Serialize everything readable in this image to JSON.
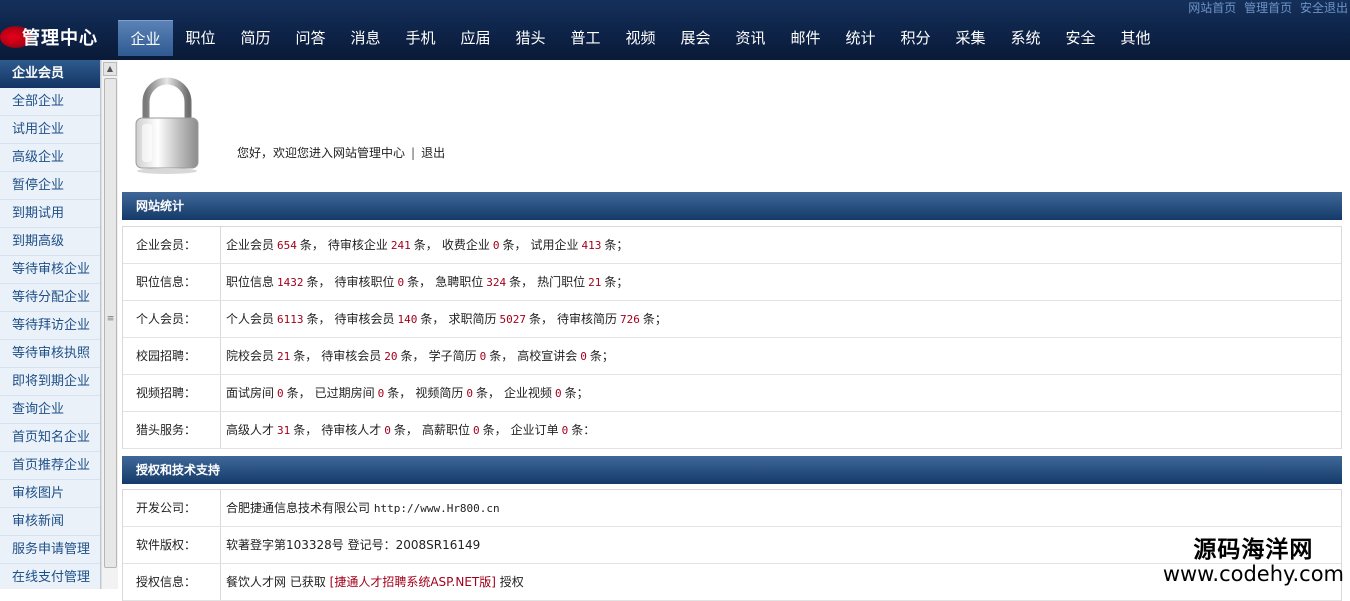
{
  "header": {
    "top_links": [
      "网站首页",
      "管理首页",
      "安全退出"
    ],
    "logo_text": "管理中心",
    "nav": [
      "企业",
      "职位",
      "简历",
      "问答",
      "消息",
      "手机",
      "应届",
      "猎头",
      "普工",
      "视频",
      "展会",
      "资讯",
      "邮件",
      "统计",
      "积分",
      "采集",
      "系统",
      "安全",
      "其他"
    ],
    "active_nav": "企业"
  },
  "sidebar": {
    "title": "企业会员",
    "items": [
      "全部企业",
      "试用企业",
      "高级企业",
      "暂停企业",
      "到期试用",
      "到期高级",
      "等待审核企业",
      "等待分配企业",
      "等待拜访企业",
      "等待审核执照",
      "即将到期企业",
      "查询企业",
      "首页知名企业",
      "首页推荐企业",
      "审核图片",
      "审核新闻",
      "服务申请管理",
      "在线支付管理"
    ]
  },
  "welcome": {
    "text": "您好，欢迎您进入网站管理中心",
    "separator": "|",
    "logout": "退出"
  },
  "stats": {
    "title": "网站统计",
    "rows": [
      {
        "label": "企业会员：",
        "parts": [
          [
            "企业会员",
            "654",
            "条，"
          ],
          [
            "待审核企业",
            "241",
            "条，"
          ],
          [
            "收费企业",
            "0",
            "条，"
          ],
          [
            "试用企业",
            "413",
            "条；"
          ]
        ]
      },
      {
        "label": "职位信息：",
        "parts": [
          [
            "职位信息",
            "1432",
            "条，"
          ],
          [
            "待审核职位",
            "0",
            "条，"
          ],
          [
            "急聘职位",
            "324",
            "条，"
          ],
          [
            "热门职位",
            "21",
            "条；"
          ]
        ]
      },
      {
        "label": "个人会员：",
        "parts": [
          [
            "个人会员",
            "6113",
            "条，"
          ],
          [
            "待审核会员",
            "140",
            "条，"
          ],
          [
            "求职简历",
            "5027",
            "条，"
          ],
          [
            "待审核简历",
            "726",
            "条；"
          ]
        ]
      },
      {
        "label": "校园招聘：",
        "parts": [
          [
            "院校会员",
            "21",
            "条，"
          ],
          [
            "待审核会员",
            "20",
            "条，"
          ],
          [
            "学子简历",
            "0",
            "条，"
          ],
          [
            "高校宣讲会",
            "0",
            "条；"
          ]
        ]
      },
      {
        "label": "视频招聘：",
        "parts": [
          [
            "面试房间",
            "0",
            "条，"
          ],
          [
            "已过期房间",
            "0",
            "条，"
          ],
          [
            "视频简历",
            "0",
            "条，"
          ],
          [
            "企业视频",
            "0",
            "条；"
          ]
        ]
      },
      {
        "label": "猎头服务：",
        "parts": [
          [
            "高级人才",
            "31",
            "条，"
          ],
          [
            "待审核人才",
            "0",
            "条，"
          ],
          [
            "高薪职位",
            "0",
            "条，"
          ],
          [
            "企业订单",
            "0",
            "条："
          ]
        ]
      }
    ]
  },
  "support": {
    "title": "授权和技术支持",
    "company_label": "开发公司：",
    "company_name": "合肥捷通信息技术有限公司",
    "company_url": "http://www.Hr800.cn",
    "copyright_label": "软件版权：",
    "copyright_text": "软著登字第103328号 登记号：2008SR16149",
    "license_label": "授权信息：",
    "license_prefix": "餐饮人才网 已获取",
    "license_product": "[捷通人才招聘系统ASP.NET版]",
    "license_suffix": "授权"
  },
  "watermark": {
    "cn": "源码海洋网",
    "en": "www.codehy.com"
  }
}
